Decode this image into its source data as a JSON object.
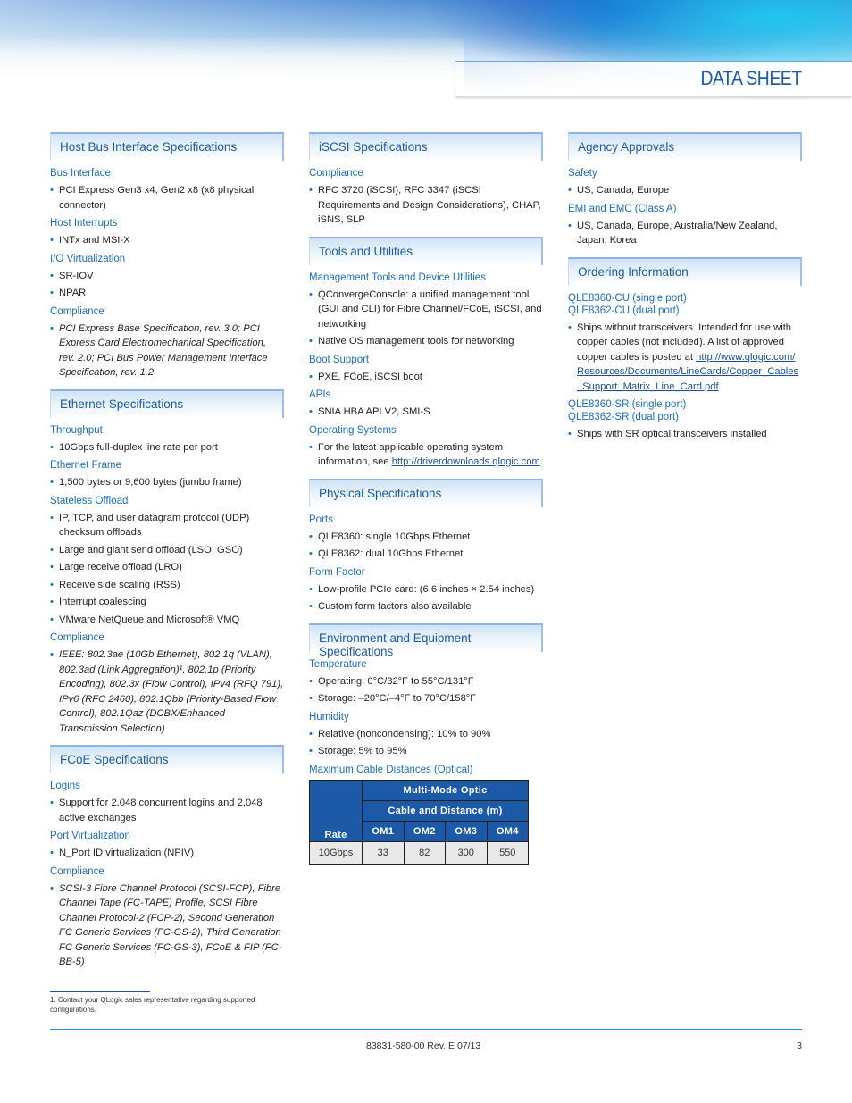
{
  "header": {
    "title": "DATA SHEET"
  },
  "columns": [
    {
      "sections": [
        {
          "title": "Host Bus Interface Specifications",
          "groups": [
            {
              "label": "Bus Interface",
              "items": [
                "PCI Express Gen3 x4, Gen2 x8 (x8 physical connector)"
              ]
            },
            {
              "label": "Host Interrupts",
              "items": [
                "INTx and MSI-X"
              ]
            },
            {
              "label": "I/O Virtualization",
              "items": [
                "SR-IOV",
                "NPAR"
              ]
            },
            {
              "label": "Compliance",
              "items": [
                "PCI Express Base Specification, rev. 3.0; PCI Express Card Electromechanical Specification, rev. 2.0; PCI Bus Power Management Interface Specification, rev. 1.2"
              ]
            }
          ]
        },
        {
          "title": "Ethernet Specifications",
          "groups": [
            {
              "label": "Throughput",
              "items": [
                "10Gbps full-duplex line rate per port"
              ]
            },
            {
              "label": "Ethernet Frame",
              "items": [
                "1,500 bytes or 9,600 bytes (jumbo frame)"
              ]
            },
            {
              "label": "Stateless Offload",
              "items": [
                "IP, TCP, and user datagram protocol (UDP) checksum offloads",
                "Large and giant send offload (LSO, GSO)",
                "Large receive offload (LRO)",
                "Receive side scaling (RSS)",
                "Interrupt coalescing",
                "VMware NetQueue and Microsoft® VMQ"
              ]
            },
            {
              "label": "Compliance",
              "items": [
                "IEEE: 802.3ae (10Gb Ethernet), 802.1q (VLAN), 802.3ad (Link Aggregation)¹, 802.1p (Priority Encoding), 802.3x (Flow Control), IPv4 (RFQ 791), IPv6 (RFC 2460), 802.1Qbb (Priority-Based Flow Control), 802.1Qaz (DCBX/Enhanced Transmission Selection)"
              ]
            }
          ]
        },
        {
          "title": "FCoE Specifications",
          "groups": [
            {
              "label": "Logins",
              "items": [
                "Support for 2,048 concurrent logins and 2,048 active exchanges"
              ]
            },
            {
              "label": "Port Virtualization",
              "items": [
                "N_Port ID virtualization (NPIV)"
              ]
            },
            {
              "label": "Compliance",
              "items": [
                "SCSI-3 Fibre Channel Protocol (SCSI-FCP), Fibre Channel Tape (FC-TAPE) Profile, SCSI Fibre Channel Protocol-2 (FCP-2), Second Generation FC Generic Services (FC-GS-2), Third Generation FC Generic Services (FC-GS-3), FCoE & FIP (FC-BB-5)"
              ]
            }
          ]
        }
      ]
    },
    {
      "sections": [
        {
          "title": "iSCSI Specifications",
          "groups": [
            {
              "label": "Compliance",
              "items": [
                "RFC 3720 (iSCSI), RFC 3347 (iSCSI Requirements and Design Considerations), CHAP, iSNS, SLP"
              ]
            }
          ]
        },
        {
          "title": "Tools and Utilities",
          "groups": [
            {
              "label": "Management Tools and Device Utilities",
              "items": [
                "QConvergeConsole: a unified management tool (GUI and CLI) for Fibre Channel/FCoE, iSCSI, and networking",
                "Native OS management tools for networking"
              ]
            },
            {
              "label": "Boot Support",
              "items": [
                "PXE, FCoE, iSCSI boot"
              ]
            },
            {
              "label": "APIs",
              "items": [
                "SNIA HBA API V2, SMI-S"
              ]
            },
            {
              "label": "Operating Systems",
              "items": [
                "For the latest applicable operating system information, see"
              ],
              "link": "http://driverdownloads.qlogic.com"
            }
          ]
        },
        {
          "title": "Physical Specifications",
          "groups": [
            {
              "label": "Ports",
              "items": [
                "QLE8360: single 10Gbps Ethernet",
                "QLE8362: dual 10Gbps Ethernet"
              ]
            },
            {
              "label": "Form Factor",
              "items": [
                "Low-profile PCIe card: (6.6 inches × 2.54 inches)",
                "Custom form factors also available"
              ]
            }
          ]
        },
        {
          "title": "Environment and Equipment Specifications",
          "groups": [
            {
              "label": "Temperature",
              "items": [
                "Operating: 0°C/32°F to 55°C/131°F",
                "Storage: –20°C/–4°F to 70°C/158°F"
              ]
            },
            {
              "label": "Humidity",
              "items": [
                "Relative (noncondensing): 10% to 90%",
                "Storage: 5% to 95%"
              ]
            },
            {
              "label": "Maximum Cable Distances (Optical)",
              "items": []
            }
          ],
          "table": {
            "rate_header": "Rate",
            "group_header": "Multi-Mode Optic",
            "sub_header": "Cable and Distance (m)",
            "columns": [
              "OM1",
              "OM2",
              "OM3",
              "OM4"
            ],
            "rows": [
              {
                "rate": "10Gbps",
                "values": [
                  "33",
                  "82",
                  "300",
                  "550"
                ]
              }
            ]
          }
        }
      ]
    },
    {
      "sections": [
        {
          "title": "Agency Approvals",
          "groups": [
            {
              "label": "Safety",
              "items": [
                "US, Canada, Europe"
              ]
            },
            {
              "label": "EMI and EMC (Class A)",
              "items": [
                "US, Canada, Europe, Australia/New Zealand, Japan, Korea"
              ]
            }
          ]
        },
        {
          "title": "Ordering Information",
          "groups": [
            {
              "label": "QLE8360-CU (single port)",
              "label2": "QLE8362-CU (dual port)",
              "items": [
                "Ships without transceivers. Intended for use with copper cables (not included). A list of approved copper cables is posted at"
              ],
              "link": "http://www.qlogic.com/Resources/Documents/LineCards/Copper_Cables_Support_Matrix_Line_Card.pdf"
            },
            {
              "label": "QLE8360-SR (single port)",
              "label2": "QLE8362-SR (dual port)",
              "items": [
                "Ships with SR optical transceivers installed"
              ]
            }
          ]
        }
      ]
    }
  ],
  "footnote": "1.   Contact your QLogic sales representative regarding supported configurations.",
  "footer": {
    "doc_id": "83831-580-00 Rev. E  07/13",
    "page": "3"
  }
}
